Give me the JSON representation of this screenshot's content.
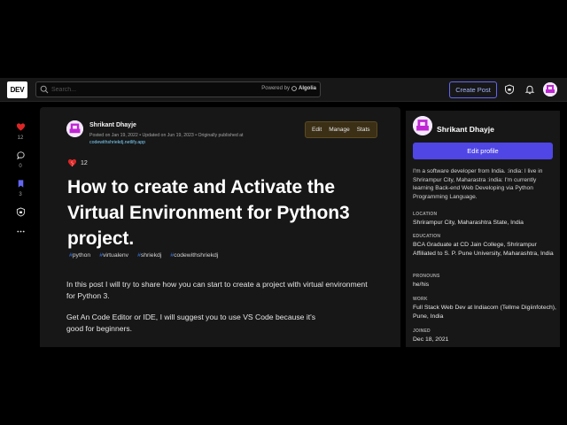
{
  "header": {
    "logo": "DEV",
    "search_placeholder": "Search...",
    "powered_by": "Powered by",
    "algolia": "Algolia",
    "create_post": "Create Post"
  },
  "reactions": [
    {
      "icon": "heart-icon",
      "count": "12"
    },
    {
      "icon": "comment-icon",
      "count": "0"
    },
    {
      "icon": "bookmark-icon",
      "count": "3"
    },
    {
      "icon": "shield-icon",
      "count": ""
    },
    {
      "icon": "more-icon",
      "count": ""
    }
  ],
  "article": {
    "author": "Shrikant Dhayje",
    "meta_prefix": "Posted on Jan 19, 2022 • Updated on Jun 19, 2023 • Originally published at",
    "meta_link": "codewithshriekdj.netlify.app",
    "actions": [
      "Edit",
      "Manage",
      "Stats"
    ],
    "likes": "12",
    "title": "How to create and Activate the Virtual Environment for Python3 project.",
    "tags": [
      "python",
      "virtualenv",
      "shriekdj",
      "codewithshriekdj"
    ],
    "paragraphs": [
      "In this post I will try to share how you can start to create a project with virtual environment for Python 3.",
      "Get An Code Editor or IDE, I will suggest you to use VS Code because it's good for beginners."
    ]
  },
  "profile": {
    "name": "Shrikant Dhayje",
    "edit_label": "Edit profile",
    "bio": "I'm a software developer from India. :india: I live in Shrirampur City, Maharastra :india: I'm currently learning Back-end Web Developing via Python Programming Language.",
    "fields": [
      {
        "label": "Location",
        "value": "Shrirampur City, Maharashtra State, India"
      },
      {
        "label": "Education",
        "value": "BCA Graduate at CD Jain College, Shrirampur Affiliated to S. P. Pune University, Maharashtra, India"
      },
      {
        "label": "Pronouns",
        "value": "he/his"
      },
      {
        "label": "Work",
        "value": "Full Stack Web Dev at Indiacom (Tellme Digiinfotech), Pune, India"
      },
      {
        "label": "Joined",
        "value": "Dec 18, 2021"
      }
    ]
  }
}
